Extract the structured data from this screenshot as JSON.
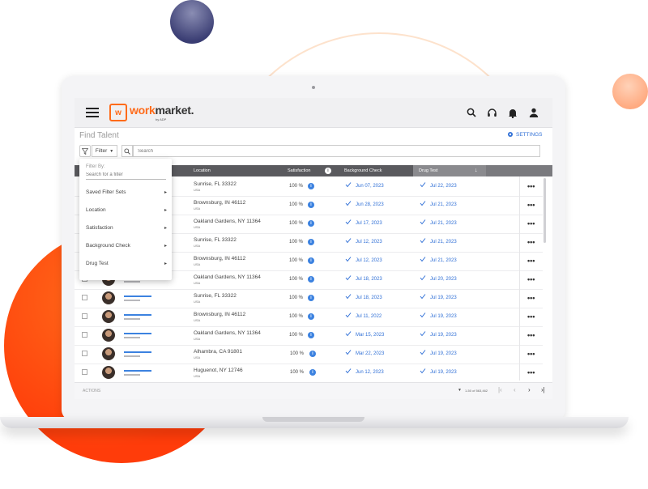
{
  "app": {
    "logo_mark": "w",
    "logo_work": "work",
    "logo_market": "market.",
    "logo_sub": "by ADP"
  },
  "header": {
    "icons": [
      "hamburger-icon",
      "search-icon",
      "headset-icon",
      "bell-icon",
      "user-icon"
    ]
  },
  "page": {
    "title": "Find Talent",
    "settings_label": "SETTINGS"
  },
  "toolbar": {
    "filter_label": "Filter",
    "search_placeholder": "Search"
  },
  "filter_menu": {
    "title": "Filter By:",
    "search_placeholder": "Search for a filter",
    "items": [
      "Saved Filter Sets",
      "Location",
      "Satisfaction",
      "Background Check",
      "Drug Test"
    ]
  },
  "table": {
    "columns": {
      "location": "Location",
      "satisfaction": "Satisfaction",
      "background": "Background Check",
      "drug": "Drug Test"
    },
    "rows": [
      {
        "city": "Sunrise, FL 33322",
        "country": "USA",
        "sat": "100 %",
        "bg": "Jun 07, 2023",
        "drug": "Jul 22, 2023"
      },
      {
        "city": "Brownsburg, IN 46112",
        "country": "USA",
        "sat": "100 %",
        "bg": "Jun 28, 2023",
        "drug": "Jul 21, 2023"
      },
      {
        "city": "Oakland Gardens, NY 11364",
        "country": "USA",
        "sat": "100 %",
        "bg": "Jul 17, 2023",
        "drug": "Jul 21, 2023"
      },
      {
        "city": "Sunrise, FL 33322",
        "country": "USA",
        "sat": "100 %",
        "bg": "Jul 12, 2023",
        "drug": "Jul 21, 2023"
      },
      {
        "city": "Brownsburg, IN 46112",
        "country": "USA",
        "sat": "100 %",
        "bg": "Jul 12, 2023",
        "drug": "Jul 21, 2023"
      },
      {
        "city": "Oakland Gardens, NY 11364",
        "country": "USA",
        "sat": "100 %",
        "bg": "Jul 18, 2023",
        "drug": "Jul 20, 2023"
      },
      {
        "city": "Sunrise, FL 33322",
        "country": "USA",
        "sat": "100 %",
        "bg": "Jul 18, 2023",
        "drug": "Jul 19, 2023"
      },
      {
        "city": "Brownsburg, IN 46112",
        "country": "USA",
        "sat": "100 %",
        "bg": "Jul    11, 2022",
        "drug": "Jul 19, 2023"
      },
      {
        "city": "Oakland Gardens, NY 11364",
        "country": "USA",
        "sat": "100 %",
        "bg": "Mar 15, 2023",
        "drug": "Jul 19, 2023"
      },
      {
        "city": "Alhambra, CA 91801",
        "country": "USA",
        "sat": "100 %",
        "bg": "Mar 22, 2023",
        "drug": "Jul 19, 2023"
      },
      {
        "city": "Huguenot, NY 12746",
        "country": "USA",
        "sat": "100 %",
        "bg": "Jun 12, 2023",
        "drug": "Jul 19, 2023"
      }
    ]
  },
  "footer": {
    "actions_label": "ACTIONS",
    "page_info": "1-50 of 563,462"
  },
  "colors": {
    "brand": "#ff6b1a",
    "link": "#2f6fd6",
    "header_dark": "#5a5a5e"
  }
}
